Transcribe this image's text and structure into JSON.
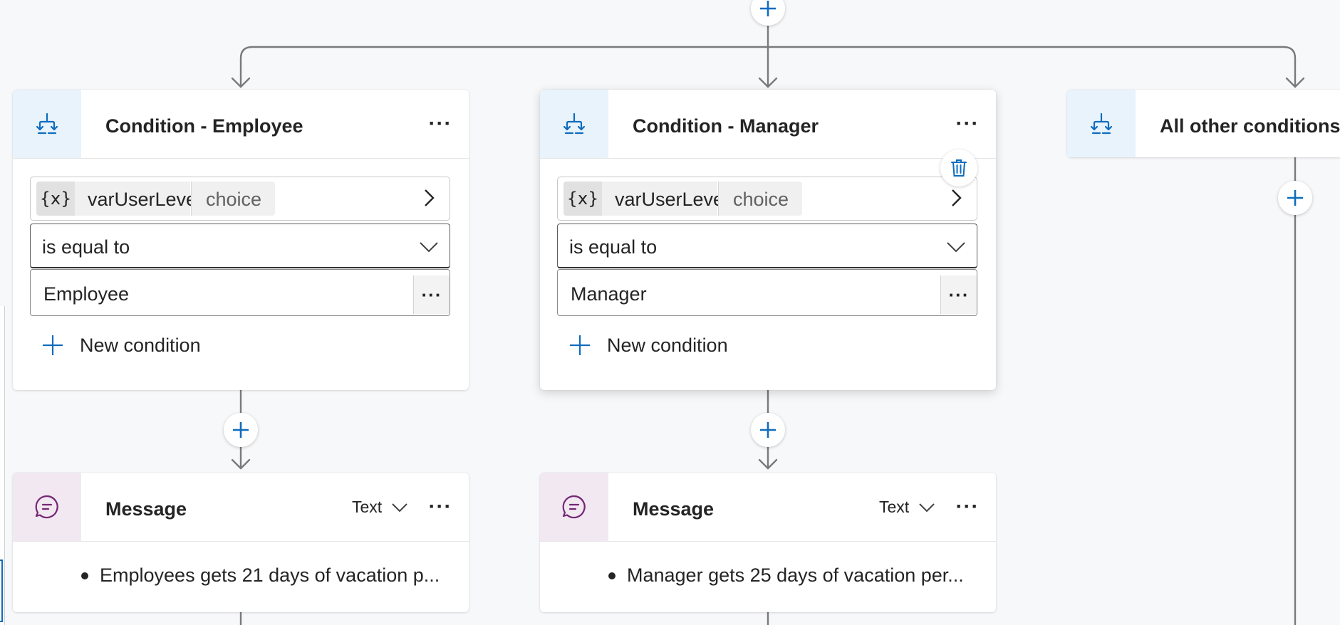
{
  "colors": {
    "accent": "#0f6cbd",
    "connector": "#7a7a7a",
    "condition_icon_bg": "#e8f3fc",
    "message_icon_bg": "#f1e8f1",
    "message_icon": "#742774",
    "canvas_bg": "#f7f8fa"
  },
  "branches": [
    {
      "condition": {
        "title": "Condition - Employee",
        "icon": "branch-condition-icon",
        "variable": {
          "icon_text": "{x}",
          "name": "varUserLevel",
          "type": "choice"
        },
        "operator": "is equal to",
        "value": "Employee",
        "new_condition_label": "New condition"
      },
      "message": {
        "title": "Message",
        "icon": "chat-message-icon",
        "type_label": "Text",
        "text": "Employees gets 21 days of vacation p..."
      }
    },
    {
      "condition": {
        "title": "Condition - Manager",
        "icon": "branch-condition-icon",
        "variable": {
          "icon_text": "{x}",
          "name": "varUserLevel",
          "type": "choice"
        },
        "operator": "is equal to",
        "value": "Manager",
        "new_condition_label": "New condition"
      },
      "message": {
        "title": "Message",
        "icon": "chat-message-icon",
        "type_label": "Text",
        "text": "Manager gets 25 days of vacation per..."
      }
    },
    {
      "condition": {
        "title": "All other conditions",
        "icon": "branch-condition-icon"
      }
    }
  ]
}
